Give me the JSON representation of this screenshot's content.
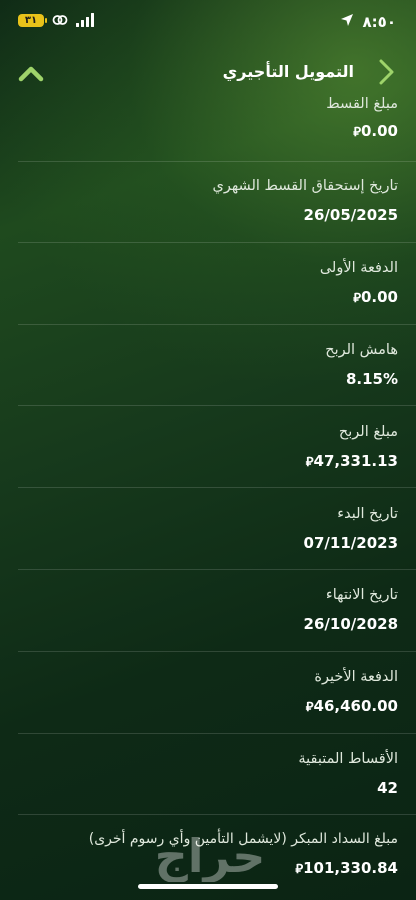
{
  "status_bar": {
    "time": "٨:٥٠",
    "battery": "٣١"
  },
  "header": {
    "title": "التمويل التأجيري"
  },
  "fields": [
    {
      "label": "مبلغ القسط",
      "value": "0.00",
      "currency": "⃁"
    },
    {
      "label": "تاريخ إستحقاق القسط الشهري",
      "value": "26/05/2025"
    },
    {
      "label": "الدفعة الأولى",
      "value": "0.00",
      "currency": "⃁"
    },
    {
      "label": "هامش الربح",
      "value": "8.15%"
    },
    {
      "label": "مبلغ الربح",
      "value": "47,331.13",
      "currency": "⃁"
    },
    {
      "label": "تاريخ البدء",
      "value": "07/11/2023"
    },
    {
      "label": "تاريخ الانتهاء",
      "value": "26/10/2028"
    },
    {
      "label": "الدفعة الأخيرة",
      "value": "46,460.00",
      "currency": "⃁"
    },
    {
      "label": "الأقساط المتبقية",
      "value": "42"
    },
    {
      "label": "مبلغ السداد المبكر (لايشمل التأمين وأي رسوم أخرى)",
      "value": "101,330.84",
      "currency": "⃁"
    }
  ],
  "watermark_text": "حراج",
  "colors": {
    "accent": "#9ed36a",
    "background": "#163a1c",
    "battery": "#e9c21a"
  }
}
